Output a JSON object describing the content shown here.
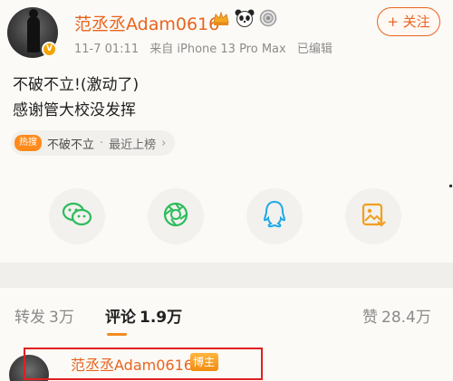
{
  "header": {
    "username": "范丞丞Adam0616",
    "timestamp": "11-7 01:11",
    "source": "来自 iPhone 13 Pro Max",
    "edited": "已编辑",
    "follow_label": "+ 关注",
    "badges": [
      "crown-icon",
      "panda-icon",
      "medal-icon"
    ],
    "verified_icon": "v-icon"
  },
  "post": {
    "lines": [
      "不破不立!(激动了)",
      "感谢管大校没发挥"
    ]
  },
  "hot_tag": {
    "icon_label": "热搜",
    "topic": "不破不立",
    "separator": "·",
    "rank": "最近上榜",
    "chevron": "›"
  },
  "share": {
    "items": [
      "wechat-icon",
      "moments-icon",
      "qq-icon",
      "save-image-icon"
    ]
  },
  "tabs": {
    "repost_label": "转发",
    "repost_count": "3万",
    "comment_label": "评论",
    "comment_count": "1.9万",
    "like_label": "赞",
    "like_count": "28.4万"
  },
  "comment": {
    "username": "范丞丞Adam0616",
    "badge": "博主"
  },
  "colors": {
    "accent": "#e8641e",
    "highlight_box": "#e0201f",
    "tab_underline": "#f28b22"
  }
}
